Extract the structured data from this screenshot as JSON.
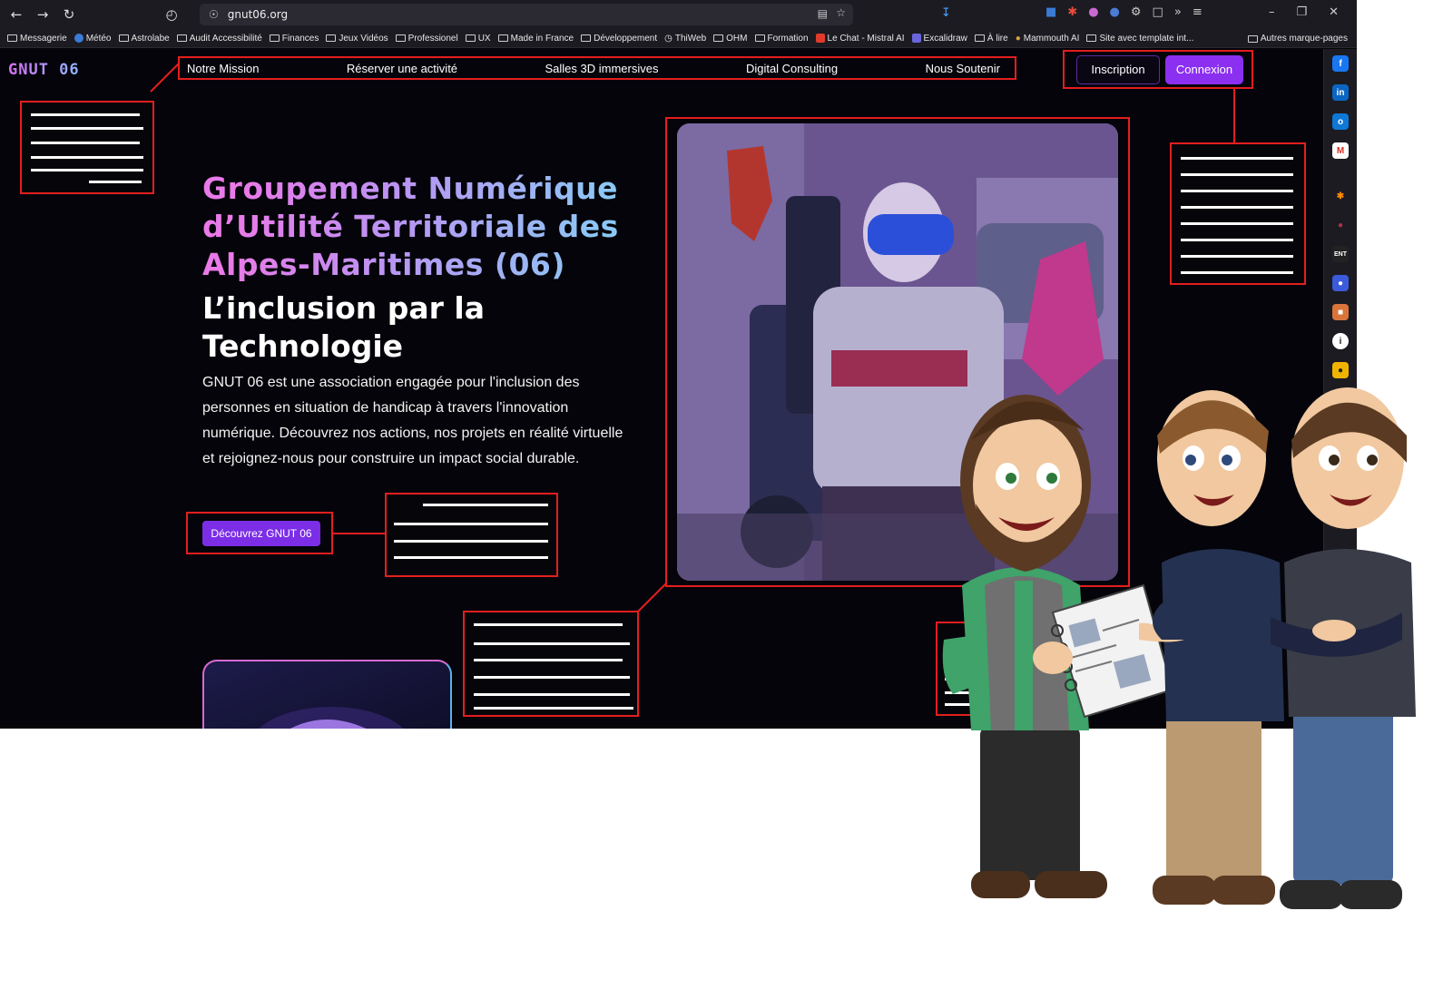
{
  "browser": {
    "url": "gnut06.org",
    "bookmarks": [
      "Messagerie",
      "Météo",
      "Astrolabe",
      "Audit Accessibilité",
      "Finances",
      "Jeux Vidéos",
      "Professionel",
      "UX",
      "Made in France",
      "Développement",
      "ThiWeb",
      "OHM",
      "Formation",
      "Le Chat - Mistral AI",
      "Excalidraw",
      "À lire",
      "Mammouth AI",
      "Site avec template int..."
    ],
    "bookmarks_other": "Autres marque-pages"
  },
  "site": {
    "logo": "GNUT 06",
    "nav": [
      "Notre Mission",
      "Réserver une activité",
      "Salles 3D immersives",
      "Digital Consulting",
      "Nous Soutenir"
    ],
    "signup_label": "Inscription",
    "login_label": "Connexion",
    "hero_title": "Groupement Numérique d’Utilité Territoriale des Alpes-Maritimes (06)",
    "hero_subtitle": "L’inclusion par la Technologie",
    "hero_text": "GNUT 06 est une association engagée pour l'inclusion des personnes en situation de handicap à travers l'innovation numérique. Découvrez nos actions, nos projets en réalité virtuelle et rejoignez-nous pour construire un impact social durable.",
    "cta_label": "Découvrez GNUT 06"
  },
  "colors": {
    "annotation": "#e41e1e",
    "accent": "#8b2ff0",
    "background": "#04040a"
  },
  "icons": [
    "back-icon",
    "forward-icon",
    "reload-icon",
    "history-icon",
    "shield-icon",
    "reader-icon",
    "star-icon",
    "download-icon",
    "extensions-icon",
    "menu-icon",
    "facebook-icon",
    "linkedin-icon",
    "outlook-icon",
    "gmail-icon"
  ]
}
